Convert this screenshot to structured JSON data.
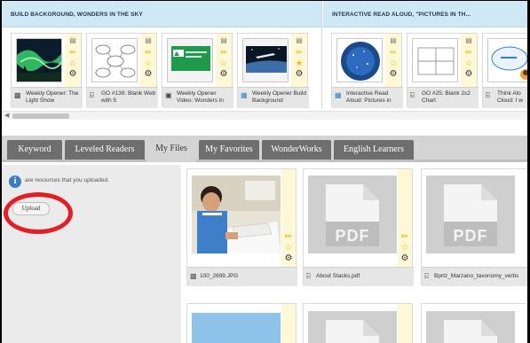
{
  "lessons": {
    "section1_title": "BUILD BACKGROUND, WONDERS IN THE SKY",
    "section2_title": "INTERACTIVE READ ALOUD, \"PICTURES IN TH...",
    "cards": [
      {
        "caption": "Weekly Opener: The Light Show",
        "icon": "presentation-icon"
      },
      {
        "caption": "GO #139: Blank Web with 5",
        "icon": "pdf-icon"
      },
      {
        "caption": "Weekly Opener Video: Wonders in",
        "icon": "video-icon"
      },
      {
        "caption": "Weekly Opener Build Background",
        "icon": "image-icon"
      },
      {
        "caption": "Interactive Read Aloud: Pictures in",
        "icon": "image-icon"
      },
      {
        "caption": "GO #25: Blank 2x2 Chart",
        "icon": "pdf-icon"
      },
      {
        "caption": "Think Alo Cloud: I w",
        "icon": "pdf-icon"
      }
    ]
  },
  "tabs": [
    {
      "label": "Keyword",
      "active": false
    },
    {
      "label": "Leveled Readers",
      "active": false
    },
    {
      "label": "My Files",
      "active": true
    },
    {
      "label": "My Favorites",
      "active": false
    },
    {
      "label": "WonderWorks",
      "active": false
    },
    {
      "label": "English Learners",
      "active": false
    }
  ],
  "myfiles": {
    "info_text": "are resources that you uploaded.",
    "upload_label": "Upload",
    "files": [
      {
        "caption": "100_2699.JPG",
        "kind": "photo"
      },
      {
        "caption": "About Stacks.pdf",
        "kind": "pdf",
        "thumb_label": "PDF"
      },
      {
        "caption": "Bprtz_Marzano_taxonomy_verbs",
        "kind": "pdf",
        "thumb_label": "PDF"
      }
    ]
  },
  "colors": {
    "section_header_bg": "#cfe8f6",
    "tab_inactive": "#6e6e6e",
    "tab_active": "#d4d4d4",
    "annotation_red": "#e41e26",
    "card_side_yellow": "#fff8d6"
  }
}
